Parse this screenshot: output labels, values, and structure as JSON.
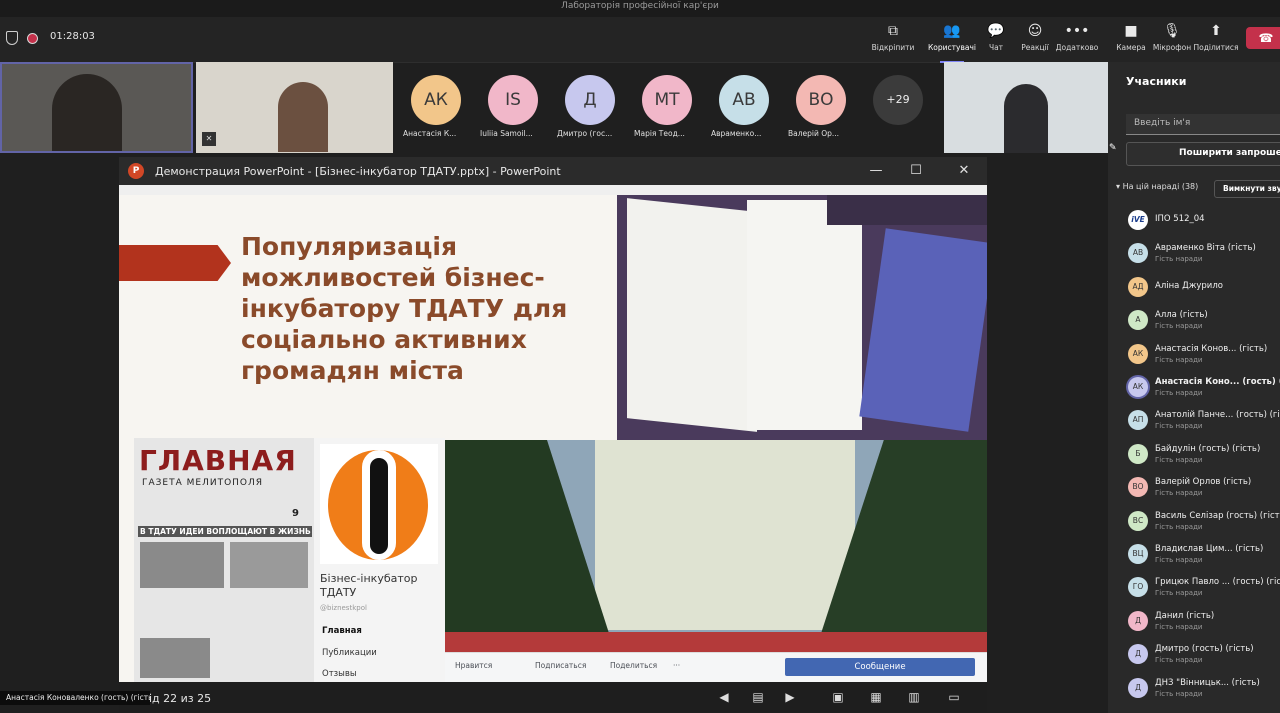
{
  "window": {
    "title": "Лабораторія професійної кар'єри"
  },
  "toolbar": {
    "timer": "01:28:03",
    "buttons": [
      {
        "label": "Відкріпити",
        "icon": "unpin-icon"
      },
      {
        "label": "Користувачі",
        "icon": "people-icon"
      },
      {
        "label": "Чат",
        "icon": "chat-icon"
      },
      {
        "label": "Реакції",
        "icon": "reactions-icon"
      },
      {
        "label": "Додатково",
        "icon": "more-icon"
      },
      {
        "label": "Камера",
        "icon": "camera-icon"
      },
      {
        "label": "Мікрофон",
        "icon": "mic-off-icon"
      },
      {
        "label": "Поділитися",
        "icon": "share-icon"
      }
    ]
  },
  "strip": {
    "avatars": [
      {
        "initials": "АК",
        "name": "Анастасія К...",
        "color": "#f2c68a"
      },
      {
        "initials": "IS",
        "name": "Iuliia Samoil...",
        "color": "#f1b7c9"
      },
      {
        "initials": "Д",
        "name": "Дмитро (гос...",
        "color": "#c7c8ee"
      },
      {
        "initials": "МТ",
        "name": "Марія Теод...",
        "color": "#f1b7c9"
      },
      {
        "initials": "АВ",
        "name": "Авраменко...",
        "color": "#c6dfe8"
      },
      {
        "initials": "ВО",
        "name": "Валерій Ор...",
        "color": "#f3b8b3"
      }
    ],
    "overflow": "+29"
  },
  "ppt": {
    "title": "Демонстрация PowerPoint - [Бізнес-інкубатор ТДАТУ.pptx] - PowerPoint",
    "logo": "P",
    "slide_title": "Популяризація можливостей бізнес-інкубатору ТДАТУ для соціально активних громадян міста",
    "newspaper_title": "ГЛАВНАЯ",
    "newspaper_sub": "ГАЗЕТА МЕЛИТОПОЛЯ",
    "newspaper_headline": "В ТДАТУ ИДЕИ ВОПЛОЩАЮТ В ЖИЗНЬ",
    "newspaper_page": "9",
    "fb_name": "Бізнес-інкубатор ТДАТУ",
    "fb_handle": "@biznestkpol",
    "fb_menu": [
      "Главная",
      "Публикации",
      "Отзывы"
    ],
    "fb_actions": [
      "Нравится",
      "Подписаться",
      "Поделиться",
      "···"
    ],
    "fb_message": "Сообщение",
    "counter": "ід 22 из 25"
  },
  "panel": {
    "title": "Учасники",
    "search_placeholder": "Введіть ім'я",
    "share_label": "Поширити запрошення",
    "section_label": "На цій нараді (38)",
    "mute_all": "Вимкнути звук",
    "participants": [
      {
        "initials": "iVE",
        "name": "ІПО 512_04",
        "sub": "",
        "color": "#ffffff"
      },
      {
        "initials": "АВ",
        "name": "Авраменко Віта (гість)",
        "sub": "Гість наради",
        "color": "#c6dfe8"
      },
      {
        "initials": "АД",
        "name": "Аліна Джурило",
        "sub": "",
        "color": "#f2c68a"
      },
      {
        "initials": "А",
        "name": "Алла (гість)",
        "sub": "Гість наради",
        "color": "#cfe8c6"
      },
      {
        "initials": "АК",
        "name": "Анастасія Конов... (гість)",
        "sub": "Гість наради",
        "color": "#f2c68a"
      },
      {
        "initials": "АК",
        "name": "Анастасія Коно... (гость) (гість)",
        "sub": "Гість наради",
        "color": "#c7c8ee"
      },
      {
        "initials": "АП",
        "name": "Анатолій Панче... (гость) (гість)",
        "sub": "Гість наради",
        "color": "#c6dfe8"
      },
      {
        "initials": "Б",
        "name": "Байдулін (гость) (гість)",
        "sub": "Гість наради",
        "color": "#cfe8c6"
      },
      {
        "initials": "ВО",
        "name": "Валерій Орлов (гість)",
        "sub": "Гість наради",
        "color": "#f3b8b3"
      },
      {
        "initials": "ВС",
        "name": "Василь Селізар (гость) (гість)",
        "sub": "Гість наради",
        "color": "#cfe8c6"
      },
      {
        "initials": "ВЦ",
        "name": "Владислав Цим...  (гість)",
        "sub": "Гість наради",
        "color": "#c6dfe8"
      },
      {
        "initials": "ГО",
        "name": "Грицюк Павло ... (гость) (гість)",
        "sub": "Гість наради",
        "color": "#c6dfe8"
      },
      {
        "initials": "Д",
        "name": "Данил (гість)",
        "sub": "Гість наради",
        "color": "#f1b7c9"
      },
      {
        "initials": "Д",
        "name": "Дмитро (гость) (гість)",
        "sub": "Гість наради",
        "color": "#c7c8ee"
      },
      {
        "initials": "Д",
        "name": "ДНЗ \"Вінницьк... (гість)",
        "sub": "Гість наради",
        "color": "#c7c8ee"
      }
    ]
  },
  "bottom_name": "Анастасія Коноваленко (гость) (гість)"
}
